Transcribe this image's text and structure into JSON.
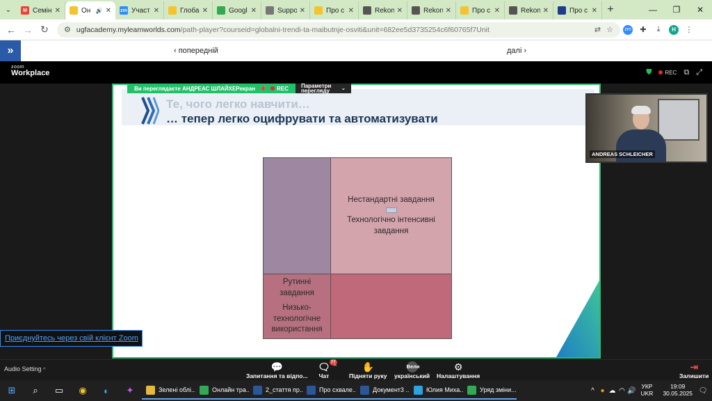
{
  "browser": {
    "tabs": [
      {
        "title": "Семін",
        "favicon_color": "#ea4335",
        "favicon_glyph": "M"
      },
      {
        "title": "Он",
        "favicon_color": "#f4c430",
        "favicon_glyph": "",
        "active": true
      },
      {
        "title": "Участ",
        "favicon_color": "#2d8cff",
        "favicon_glyph": "zm"
      },
      {
        "title": "Глоба",
        "favicon_color": "#f4c430",
        "favicon_glyph": ""
      },
      {
        "title": "Googl",
        "favicon_color": "#34a853",
        "favicon_glyph": ""
      },
      {
        "title": "Suppo",
        "favicon_color": "#777777",
        "favicon_glyph": ""
      },
      {
        "title": "Про с",
        "favicon_color": "#f4c430",
        "favicon_glyph": ""
      },
      {
        "title": "Rekon",
        "favicon_color": "#555555",
        "favicon_glyph": ""
      },
      {
        "title": "Rekon",
        "favicon_color": "#555555",
        "favicon_glyph": ""
      },
      {
        "title": "Про с",
        "favicon_color": "#f4c430",
        "favicon_glyph": ""
      },
      {
        "title": "Rekon",
        "favicon_color": "#555555",
        "favicon_glyph": ""
      },
      {
        "title": "Про с",
        "favicon_color": "#1f3b8a",
        "favicon_glyph": ""
      }
    ],
    "url_host": "ugfacademy.mylearnworlds.com",
    "url_path": "/path-player?courseid=globalni-trendi-ta-maibutnje-osviti&unit=682ee5d3735254c6f60765f7Unit",
    "profile_initial": "H"
  },
  "lms": {
    "prev_label": "‹ попередній",
    "next_label": "далі ›"
  },
  "zoom": {
    "logo_small": "zoom",
    "logo_big": "Workplace",
    "rec_label": "REC",
    "share_banner": "Ви переглядаєте АНДРЕАС ШЛАЙХЕРекран",
    "share_rec": "REC",
    "view_options": "Параметри\nперегляду",
    "participant_name": "ANDREAS SCHLEICHER",
    "join_link": "Приєднуйтесь через свій клієнт Zoom",
    "audio_setting": "Audio Setting",
    "toolbar": {
      "qa": "Запитання та відпо...",
      "chat": "Чат",
      "chat_badge": "77",
      "raise_hand": "Підняти руку",
      "language": "український",
      "language_top": "Вели",
      "settings": "Налаштування",
      "leave": "Залишити"
    }
  },
  "slide": {
    "line1": "Те, чого легко навчити…",
    "line2": "… тепер легко оцифрувати та автоматизувати",
    "top_right_1": "Нестандартні завдання",
    "top_right_2": "Технологічно інтенсивні",
    "top_right_3": "завдання",
    "bottom_left_1": "Рутинні",
    "bottom_left_2": "завдання",
    "bottom_left_3": "Низько-",
    "bottom_left_4": "технологічне",
    "bottom_left_5": "використання"
  },
  "taskbar": {
    "apps": [
      {
        "label": "Зелені облі...",
        "color": "#e8b83a"
      },
      {
        "label": "Онлайн тра...",
        "color": "#34a853"
      },
      {
        "label": "2_стаття пр...",
        "color": "#2b579a"
      },
      {
        "label": "Про схвале...",
        "color": "#2b579a"
      },
      {
        "label": "Документ3 ...",
        "color": "#2b579a"
      },
      {
        "label": "Юлия Миха...",
        "color": "#2aa3e0"
      },
      {
        "label": "Уряд зміни...",
        "color": "#34a853"
      }
    ],
    "lang_1": "УКР",
    "lang_2": "UKR",
    "time": "19:09",
    "date": "30.05.2025"
  }
}
